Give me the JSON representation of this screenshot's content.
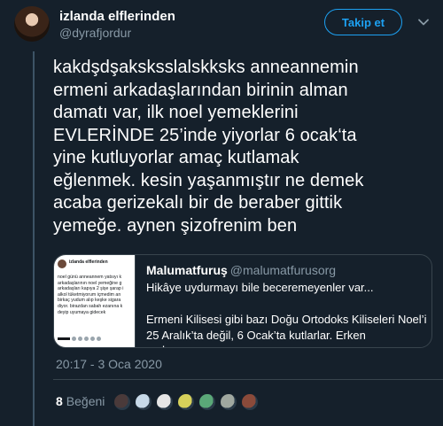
{
  "author": {
    "name": "izlanda elflerinden",
    "handle": "@dyrafjordur",
    "avatar_icon": "profile-avatar"
  },
  "follow_label": "Takip et",
  "menu_icon": "chevron-down-icon",
  "tweet_lines": [
    "kakdşdşaksksslalskksks anneannemin",
    "ermeni arkadaşlarından birinin alman",
    "damatı var, ilk noel yemeklerini",
    "EVLERİNDE 25’inde yiyorlar 6 ocak‘ta",
    "yine kutluyorlar amaç kutlamak",
    "eğlenmek. kesin yaşanmıştır ne demek",
    "acaba gerizekalı bir de beraber gittik",
    "yemeğe. aynen şizofrenim ben"
  ],
  "quote": {
    "name": "Malumatfuruş",
    "handle": "@malumatfurusorg",
    "text_line1": "Hikâye uydurmayı bile beceremeyenler var...",
    "text_line2": "Ermeni Kilisesi gibi bazı Doğu Ortodoks Kiliseleri Noel’i 25 Aralık’ta değil, 6 Ocak’ta kutlarlar. Erken uydurmuş...",
    "thumbnail": {
      "name": "izlanda elflerinden",
      "text": "noel günü anneannem yatsıyı k\narkadaşlarının noel yemeğine g\narkadaşları kapıya 2 şişe şarap i\nalkol tüketmiyorum içmedim an\nbirkaç yudum alıp keşke sigara\ndiyor. birazdan sabah ezanına k\ndeyip uyumaya gidecek"
    }
  },
  "timestamp": "20:17 - 3 Oca 2020",
  "likes": {
    "count": "8",
    "label": "Beğeni",
    "liker_colors": [
      "#4a3a3a",
      "#c7d9e8",
      "#e6e6e6",
      "#d6d05a",
      "#5aa878",
      "#a0a8a0",
      "#8a4a3a"
    ]
  }
}
